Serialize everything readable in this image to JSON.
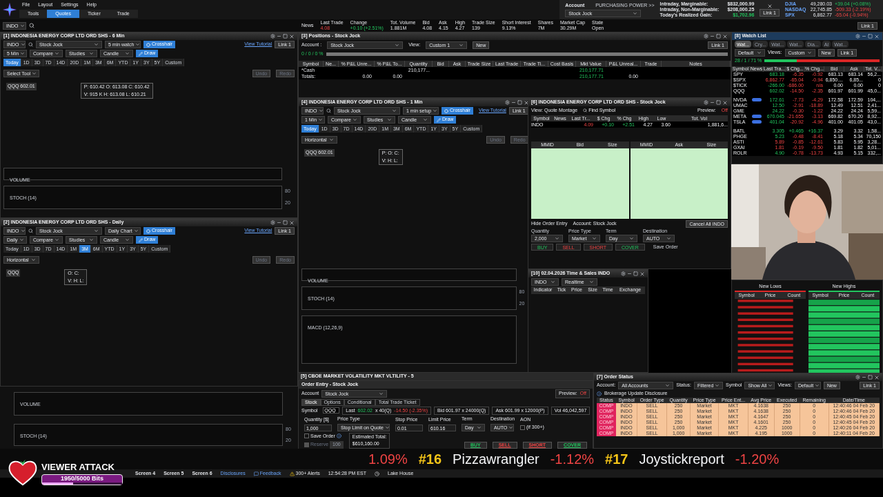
{
  "menu": [
    "File",
    "Layout",
    "Settings",
    "Help"
  ],
  "nav_tabs": [
    {
      "label": "Tools",
      "selected": false
    },
    {
      "label": "Quotes",
      "selected": true
    },
    {
      "label": "Ticker",
      "selected": false
    },
    {
      "label": "Trade",
      "selected": false
    }
  ],
  "symbol": "INDO",
  "quote": [
    {
      "label": "News"
    },
    {
      "label": "Last Trade",
      "value": "4.08",
      "negative": true
    },
    {
      "label": "Change",
      "value": "+0.10 (+2.51%)",
      "negative": false
    },
    {
      "label": "Tot. Volume",
      "value": "1.881M"
    },
    {
      "label": "Bid",
      "value": "4.08"
    },
    {
      "label": "Ask",
      "value": "4.15"
    },
    {
      "label": "High",
      "value": "4.27"
    },
    {
      "label": "Trade Size",
      "value": "139"
    },
    {
      "label": "Short Interest",
      "value": "9.13%"
    },
    {
      "label": "Shares",
      "value": "7M"
    },
    {
      "label": "Market Cap",
      "value": "30.29M"
    },
    {
      "label": "State",
      "value": "Open"
    }
  ],
  "quote_link": "Link 1",
  "account": {
    "label": "Account",
    "name": "Stock Jock",
    "power": "PURCHASING POWER >>",
    "link": "Link 1",
    "rows": [
      {
        "label": "Intraday, Marginable:",
        "value": "$832,000.99"
      },
      {
        "label": "Intraday, Non-Marginable:",
        "value": "$208,000.25"
      },
      {
        "label": "Today's Realized Gain:",
        "value": "$1,702.96",
        "negative": false
      }
    ]
  },
  "indices": [
    {
      "name": "DJIA",
      "value": "49,280.03",
      "change": "+39.04 (+0.08%)",
      "negative": false
    },
    {
      "name": "NASDAQ",
      "value": "22,745.85",
      "change": "-509.33 (-2.19%)",
      "negative": true
    },
    {
      "name": "SPX",
      "value": "6,862.77",
      "change": "-65.04 (-0.94%)",
      "negative": true
    }
  ],
  "charts": [
    {
      "kind": "full",
      "title": "[1] INDONESIA ENERGY CORP LTD ORD SHS - 6 Min",
      "symbol": "INDO",
      "account": "Stock Jock",
      "setup": "5 min watch",
      "crosshair": "Crosshair",
      "tutorial": "View Tutorial",
      "link": "Link 1",
      "interval": "5 Min",
      "compare": "Compare",
      "studies": "Studies",
      "style": "Candle",
      "draw": "Draw",
      "ranges": [
        {
          "label": "Today",
          "selected": true
        },
        {
          "label": "1D",
          "selected": false
        },
        {
          "label": "3D",
          "selected": false
        },
        {
          "label": "7D",
          "selected": false
        },
        {
          "label": "14D",
          "selected": false
        },
        {
          "label": "20D",
          "selected": false
        },
        {
          "label": "1M",
          "selected": false
        },
        {
          "label": "3M",
          "selected": false
        },
        {
          "label": "6M",
          "selected": false
        },
        {
          "label": "YTD",
          "selected": false
        },
        {
          "label": "1Y",
          "selected": false
        },
        {
          "label": "3Y",
          "selected": false
        },
        {
          "label": "5Y",
          "selected": false
        },
        {
          "label": "Custom",
          "selected": false
        }
      ],
      "tool": "Select Tool",
      "undo": "Undo",
      "redo": "Redo",
      "quote_label": "QQQ 602.01",
      "ohlc": [
        "P: 610.42  O: 613.08  C: 610.42",
        "V: 915 K  H: 613.08  L: 610.21"
      ],
      "panes": [
        {
          "label": "VOLUME"
        },
        {
          "label": "STOCH (14)",
          "ticks": [
            "80",
            "20"
          ]
        }
      ]
    },
    {
      "kind": "full",
      "title": "[2] INDONESIA ENERGY CORP LTD ORD SHS - Daily",
      "symbol": "INDO",
      "account": "Stock Jock",
      "setup": "Daily Chart",
      "crosshair": "Crosshair",
      "tutorial": "View Tutorial",
      "link": "Link 1",
      "interval": "Daily",
      "compare": "Compare",
      "studies": "Studies",
      "style": "Candle",
      "draw": "Draw",
      "ranges": [
        {
          "label": "Today",
          "selected": false
        },
        {
          "label": "1D",
          "selected": false
        },
        {
          "label": "3D",
          "selected": false
        },
        {
          "label": "7D",
          "selected": false
        },
        {
          "label": "14D",
          "selected": false
        },
        {
          "label": "1M",
          "selected": false
        },
        {
          "label": "3M",
          "selected": true
        },
        {
          "label": "6M",
          "selected": false
        },
        {
          "label": "YTD",
          "selected": false
        },
        {
          "label": "1Y",
          "selected": false
        },
        {
          "label": "3Y",
          "selected": false
        },
        {
          "label": "5Y",
          "selected": false
        },
        {
          "label": "Custom",
          "selected": false
        }
      ],
      "tool": "Horizontal",
      "undo": "Undo",
      "redo": "Redo",
      "quote_label": "QQQ",
      "ohlc": [
        "O:  C:",
        "V:  H:  L:"
      ]
    },
    {
      "kind": "panes_only",
      "panes": [
        {
          "label": "VOLUME"
        },
        {
          "label": "STOCH (14)",
          "ticks": [
            "80",
            "20"
          ]
        }
      ]
    },
    {
      "kind": "full",
      "title": "[4] INDONESIA ENERGY CORP LTD ORD SHS - 1 Min",
      "symbol": "INDO",
      "account": "Stock Jock",
      "setup": "1 min setup",
      "crosshair": "Crosshair",
      "tutorial": "View Tutorial",
      "link": "Link 1",
      "interval": "1 Min",
      "compare": "Compare",
      "studies": "Studies",
      "style": "Candle",
      "draw": "Draw",
      "ranges": [
        {
          "label": "Today",
          "selected": true
        },
        {
          "label": "1D",
          "selected": false
        },
        {
          "label": "3D",
          "selected": false
        },
        {
          "label": "7D",
          "selected": false
        },
        {
          "label": "14D",
          "selected": false
        },
        {
          "label": "20D",
          "selected": false
        },
        {
          "label": "1M",
          "selected": false
        },
        {
          "label": "3M",
          "selected": false
        },
        {
          "label": "6M",
          "selected": false
        },
        {
          "label": "YTD",
          "selected": false
        },
        {
          "label": "1Y",
          "selected": false
        },
        {
          "label": "3Y",
          "selected": false
        },
        {
          "label": "5Y",
          "selected": false
        },
        {
          "label": "Custom",
          "selected": false
        }
      ],
      "tool": "Horizontal",
      "undo": "Undo",
      "redo": "Redo",
      "quote_label": "QQQ 602.01",
      "ohlc": [
        "P:  O:  C:",
        "V:  H:  L:"
      ],
      "panes": [
        {
          "label": "VOLUME"
        },
        {
          "label": "STOCH (14)",
          "ticks": [
            "80",
            "20"
          ]
        },
        {
          "label": "MACD (12,26,9)"
        }
      ]
    }
  ],
  "positions": {
    "title": "[3] Positions  - Stock Jock",
    "account_label": "Account :",
    "account": "Stock Jock",
    "view_label": "View:",
    "view": "Custom 1",
    "new": "New",
    "link": "Link 1",
    "ratio": "0 / 0 / 0 %",
    "columns": [
      {
        "label": "Symbol"
      },
      {
        "label": "Ne..."
      },
      {
        "label": "% P&L Unre..."
      },
      {
        "label": "% P&L To..."
      },
      {
        "label": "Quantity"
      },
      {
        "label": "Bid"
      },
      {
        "label": "Ask"
      },
      {
        "label": "Trade Size"
      },
      {
        "label": "Last Trade"
      },
      {
        "label": "Trade Ti..."
      },
      {
        "label": "Cost Basis"
      },
      {
        "label": "Mkt Value",
        "negative": false
      },
      {
        "label": "P&L Unreal..."
      },
      {
        "label": "Trade"
      },
      {
        "label": "Notes"
      }
    ],
    "rows": [
      [
        "*Cash",
        "",
        "",
        "",
        "210,177...",
        "",
        "",
        "",
        "",
        "",
        "",
        "210,177.71",
        "",
        "",
        ""
      ],
      [
        "Totals:",
        "",
        "0.00",
        "0.00",
        "",
        "",
        "",
        "",
        "",
        "",
        "",
        "210,177.71",
        "0.00",
        "",
        ""
      ]
    ]
  },
  "watchlist": {
    "title": "[8] Watch List",
    "tabs": [
      {
        "label": "Wat...",
        "selected": true
      },
      {
        "label": "Cry...",
        "selected": false
      },
      {
        "label": "Wat...",
        "selected": false
      },
      {
        "label": "Wat...",
        "selected": false
      },
      {
        "label": "Dia...",
        "selected": false
      },
      {
        "label": "AI",
        "selected": false
      },
      {
        "label": "Wat...",
        "selected": false
      }
    ],
    "list": "Default",
    "views_label": "Views:",
    "view": "Custom",
    "new": "New",
    "link": "Link 1",
    "ratio": "28 / 1 / 71 %",
    "level": 0.28,
    "columns": [
      "Symbol",
      "News",
      "Last Tra...",
      "$ Chg...",
      "% Chg...",
      "Bid",
      "Ask",
      "Tot. V..."
    ],
    "rows": [
      {
        "kind": "quote",
        "symbol": "SPY",
        "news": false,
        "last": "683.18",
        "last_negative": false,
        "chg": "-6.35",
        "pct": "-0.92",
        "chg_negative": true,
        "bid": "683.13",
        "ask": "683.14",
        "vol": "56,2..."
      },
      {
        "kind": "quote",
        "symbol": "$SPX",
        "news": false,
        "last": "6,862.77",
        "last_negative": true,
        "chg": "-65.04",
        "pct": "-0.94",
        "chg_negative": true,
        "bid": "6,850....",
        "ask": "6,85...",
        "vol": "0"
      },
      {
        "kind": "quote",
        "symbol": "$TICK",
        "news": false,
        "last": "-266.00",
        "last_negative": false,
        "chg": "-686.00",
        "pct": "n/a",
        "chg_negative": true,
        "bid": "0.00",
        "ask": "0.00",
        "vol": "0"
      },
      {
        "kind": "quote",
        "symbol": "QQQ",
        "news": false,
        "last": "602.02",
        "last_negative": false,
        "chg": "-14.50",
        "pct": "-2.35",
        "chg_negative": true,
        "bid": "601.97",
        "ask": "601.99",
        "vol": "45,0..."
      },
      {
        "kind": "spacer"
      },
      {
        "kind": "quote",
        "symbol": "NVDA",
        "news": true,
        "last": "172.61",
        "last_negative": false,
        "chg": "-7.73",
        "pct": "-4.29",
        "chg_negative": true,
        "bid": "172.58",
        "ask": "172.59",
        "vol": "104,..."
      },
      {
        "kind": "quote",
        "symbol": "UMAC",
        "news": false,
        "last": "12.50",
        "last_negative": false,
        "chg": "-2.91",
        "pct": "-18.89",
        "chg_negative": true,
        "bid": "12.49",
        "ask": "12.51",
        "vol": "2,41..."
      },
      {
        "kind": "quote",
        "symbol": "GME",
        "news": false,
        "last": "24.22",
        "last_negative": false,
        "chg": "-0.30",
        "pct": "-1.22",
        "chg_negative": true,
        "bid": "24.22",
        "ask": "24.24",
        "vol": "5,59..."
      },
      {
        "kind": "quote",
        "symbol": "META",
        "news": true,
        "last": "670.045",
        "last_negative": false,
        "chg": "-21.655",
        "pct": "-3.13",
        "chg_negative": true,
        "bid": "669.82",
        "ask": "670.20",
        "vol": "8,92..."
      },
      {
        "kind": "quote",
        "symbol": "TSLA",
        "news": true,
        "last": "401.04",
        "last_negative": false,
        "chg": "-20.92",
        "pct": "-4.96",
        "chg_negative": true,
        "bid": "401.00",
        "ask": "401.05",
        "vol": "43,0..."
      },
      {
        "kind": "spacer"
      },
      {
        "kind": "quote",
        "symbol": "BATL",
        "news": false,
        "last": "3.305",
        "last_negative": false,
        "chg": "+0.465",
        "pct": "+16.37",
        "chg_negative": false,
        "bid": "3.29",
        "ask": "3.32",
        "vol": "1,58..."
      },
      {
        "kind": "quote",
        "symbol": "PHGE",
        "news": false,
        "last": "5.23",
        "last_negative": false,
        "chg": "-0.48",
        "pct": "-8.41",
        "chg_negative": true,
        "bid": "5.18",
        "ask": "5.34",
        "vol": "70,150"
      },
      {
        "kind": "quote",
        "symbol": "ASTI",
        "news": false,
        "last": "5.89",
        "last_negative": true,
        "chg": "-0.85",
        "pct": "-12.61",
        "chg_negative": true,
        "bid": "5.83",
        "ask": "5.95",
        "vol": "3,28..."
      },
      {
        "kind": "quote",
        "symbol": "GXAI",
        "news": false,
        "last": "1.81",
        "last_negative": true,
        "chg": "-0.19",
        "pct": "-9.50",
        "chg_negative": true,
        "bid": "1.81",
        "ask": "1.82",
        "vol": "5,01..."
      },
      {
        "kind": "quote",
        "symbol": "ROLR",
        "news": false,
        "last": "4.90",
        "last_negative": false,
        "chg": "-0.78",
        "pct": "-13.73",
        "chg_negative": true,
        "bid": "4.93",
        "ask": "5.15",
        "vol": "332,..."
      }
    ]
  },
  "movers": {
    "lows": {
      "title": "New Lows",
      "columns": [
        "Symbol",
        "Price",
        "Count"
      ]
    },
    "highs": {
      "title": "New Highs",
      "columns": [
        "Symbol",
        "Price",
        "Count"
      ]
    }
  },
  "level2": {
    "title": "[6] INDONESIA ENERGY CORP LTD ORD SHS - Stock Jock",
    "view": "View: Quote Montage",
    "find": "Find Symbol",
    "preview": "Preview:",
    "preview_state": "Off",
    "columns": [
      "Symbol",
      "News",
      "Last Tr...",
      "$ Chg",
      "% Chg",
      "High",
      "Low",
      "Tot. Vol"
    ],
    "row": {
      "symbol": "INDO",
      "last": "4.09",
      "last_negative": true,
      "chg": "+0.10",
      "pct": "+2.51",
      "chg_negative": false,
      "high": "4.27",
      "low": "3.60",
      "vol": "1,881,6..."
    },
    "book": [
      {
        "columns": [
          "MMID",
          "Bid",
          "Size"
        ]
      },
      {
        "columns": [
          "MMID",
          "Ask",
          "Size"
        ]
      }
    ],
    "hide": "Hide Order Entry",
    "account": "Account: Stock Jock",
    "cancel": "Cancel All INDO",
    "fields": [
      {
        "label": "Quantity",
        "value": "2,000"
      },
      {
        "label": "Price Type",
        "value": "Market"
      },
      {
        "label": "Term",
        "value": "Day"
      },
      {
        "label": "Destination",
        "value": "AUTO"
      }
    ],
    "save": "Save Order",
    "buttons": [
      {
        "label": "BUY",
        "kind": "buy"
      },
      {
        "label": "SELL",
        "kind": "sell"
      },
      {
        "label": "SHORT",
        "kind": "sell"
      },
      {
        "label": "COVER",
        "kind": "buy"
      }
    ]
  },
  "tns": {
    "title": "[10] 02.04.2026 Time & Sales INDO",
    "symbol": "INDO",
    "mode": "Realtime",
    "columns": [
      "Indicator",
      "Tick",
      "Price",
      "Size",
      "Time",
      "Exchange"
    ]
  },
  "cboe": {
    "title": "[5] CBOE MARKET VOLATILITY MKT VLTILITY - 5"
  },
  "order_entry": {
    "title": "Order Entry - Stock Jock",
    "account_label": "Account",
    "account": "Stock Jock",
    "preview": "Preview:",
    "preview_state": "Off",
    "tabs": [
      {
        "label": "Stock",
        "selected": true
      },
      {
        "label": "Options",
        "selected": false
      },
      {
        "label": "Conditional",
        "selected": false
      },
      {
        "label": "Total Trade Ticket",
        "selected": false
      }
    ],
    "symbol_label": "Symbol",
    "symbol": "QQQ",
    "last": "Last",
    "last_value": "602.02",
    "last_negative": false,
    "last_size": "x 40(Q)",
    "change": "-14.50 (-2.35%)",
    "change_negative": true,
    "bid": "Bid  601.97 x 24000(Q)",
    "ask": "Ask  601.99 x 12000(P)",
    "vol": "Vol  46,042,597",
    "fields": [
      {
        "label": "Quantity   [$]",
        "value": "1,000",
        "kind": "spin"
      },
      {
        "label": "Price Type",
        "value": "Stop Limit on Quote",
        "kind": "select"
      },
      {
        "label": "Stop Price",
        "value": "0.01",
        "kind": "spin"
      },
      {
        "label": "Limit Price",
        "value": "610.16",
        "kind": "spin"
      },
      {
        "label": "Term",
        "value": "Day",
        "kind": "select"
      },
      {
        "label": "Destination",
        "value": "AUTO",
        "kind": "select"
      }
    ],
    "aon": "AON",
    "aon_note": "(if 300+)",
    "aon_checked": false,
    "save": "Save Order",
    "save_checked": false,
    "reserve": "Reserve",
    "reserve_checked": false,
    "reserve_disabled": true,
    "reserve_value": "100",
    "est_label": "Estimated Total:",
    "est": "$610,160.00",
    "buttons": [
      {
        "label": "BUY",
        "kind": "buy"
      },
      {
        "label": "SELL",
        "kind": "sell"
      },
      {
        "label": "SHORT",
        "kind": "sell"
      },
      {
        "label": "COVER",
        "kind": "buy"
      }
    ]
  },
  "order_status": {
    "title": "[7] Order Status",
    "account_label": "Account:",
    "account": "All Accounts",
    "status_label": "Status:",
    "status": "Filtered",
    "symbol_label": "Symbol",
    "symbol": "Show All",
    "views_label": "Views:",
    "views": "Default",
    "new": "New",
    "link": "Link 1",
    "disclosure": "Brokerage Update Disclosure",
    "columns": [
      "Status",
      "Symbol",
      "Order Type",
      "Quantity",
      "Price Type",
      "Price Ent...",
      "Avg Price",
      "Executed",
      "Remaining",
      "Date/Time"
    ],
    "rows": [
      [
        "COMP",
        "INDO",
        "SELL",
        "250",
        "Market",
        "MKT",
        "4.1638",
        "250",
        "0",
        "12:40:46 04 Feb 20"
      ],
      [
        "COMP",
        "INDO",
        "SELL",
        "250",
        "Market",
        "MKT",
        "4.1638",
        "250",
        "0",
        "12:40:46 04 Feb 20"
      ],
      [
        "COMP",
        "INDO",
        "SELL",
        "250",
        "Market",
        "MKT",
        "4.1647",
        "250",
        "0",
        "12:40:45 04 Feb 20"
      ],
      [
        "COMP",
        "INDO",
        "SELL",
        "250",
        "Market",
        "MKT",
        "4.1601",
        "250",
        "0",
        "12:40:45 04 Feb 20"
      ],
      [
        "COMP",
        "INDO",
        "SELL",
        "1,000",
        "Market",
        "MKT",
        "4.225",
        "1000",
        "0",
        "12:40:26 04 Feb 20"
      ],
      [
        "COMP",
        "INDO",
        "SELL",
        "1,000",
        "Market",
        "MKT",
        "4.195",
        "1000",
        "0",
        "12:40:11 04 Feb 20"
      ]
    ]
  },
  "ticker": [
    {
      "text": "1.09%",
      "kind": "change"
    },
    {
      "text": "#16",
      "kind": "rank"
    },
    {
      "text": "Pizzawrangler",
      "kind": "name"
    },
    {
      "text": "-1.12%",
      "kind": "change"
    },
    {
      "text": "#17",
      "kind": "rank"
    },
    {
      "text": "Joystickreport",
      "kind": "name"
    },
    {
      "text": "-1.20%",
      "kind": "change"
    }
  ],
  "overlay": {
    "title": "VIEWER ATTACK",
    "progress": "1950/5000 Bits",
    "level": 0.39
  },
  "status_bar": {
    "screens": [
      "Screen 4",
      "Screen 5",
      "Screen 6"
    ],
    "disclosures": "Disclosures",
    "feedback": "Feedback",
    "alerts": "300+ Alerts",
    "time": "12:54:28 PM EST",
    "location": "Lake House"
  }
}
